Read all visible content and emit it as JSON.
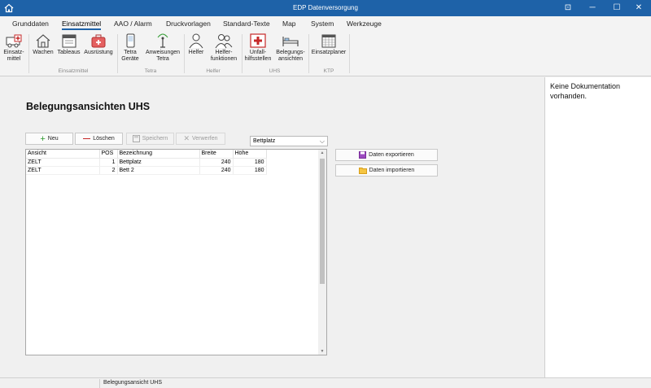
{
  "window": {
    "title": "EDP Datenversorgung",
    "pin_glyph": "⊡",
    "minimize_glyph": "─",
    "maximize_glyph": "☐",
    "close_glyph": "✕"
  },
  "tabs": [
    {
      "label": "Grunddaten"
    },
    {
      "label": "Einsatzmittel",
      "active": true
    },
    {
      "label": "AAO / Alarm"
    },
    {
      "label": "Druckvorlagen"
    },
    {
      "label": "Standard-Texte"
    },
    {
      "label": "Map"
    },
    {
      "label": "System"
    },
    {
      "label": "Werkzeuge"
    }
  ],
  "ribbon": {
    "buttons": [
      {
        "label": "Einsatz-\nmittel",
        "icon": "ambulance-icon"
      },
      {
        "label": "Wachen",
        "icon": "house-icon"
      },
      {
        "label": "Tableaus",
        "icon": "tableau-icon"
      },
      {
        "label": "Ausrüstung",
        "icon": "medkit-icon"
      },
      {
        "label": "Tetra\nGeräte",
        "icon": "phone-icon"
      },
      {
        "label": "Anweisungen\nTetra",
        "icon": "antenna-icon"
      },
      {
        "label": "Helfer",
        "icon": "person-icon"
      },
      {
        "label": "Helfer-\nfunktionen",
        "icon": "people-icon"
      },
      {
        "label": "Unfall-\nhilfsstellen",
        "icon": "first-aid-icon"
      },
      {
        "label": "Belegungs-\nansichten",
        "icon": "bed-icon"
      },
      {
        "label": "Einsatzplaner",
        "icon": "calendar-icon"
      }
    ],
    "groups": [
      "Einsatzmittel",
      "Tetra",
      "Helfer",
      "UHS",
      "KTP"
    ]
  },
  "main": {
    "page_title": "Belegungsansichten UHS",
    "toolbar": {
      "new_label": "Neu",
      "delete_label": "Löschen",
      "save_label": "Speichern",
      "discard_label": "Verwerfen"
    },
    "select": {
      "value": "Bettplatz"
    },
    "table": {
      "columns": [
        "Ansicht",
        "POS",
        "Bezeichnung",
        "Breite",
        "Höhe"
      ],
      "rows": [
        [
          "ZELT",
          "1",
          "Bettplatz",
          "240",
          "180"
        ],
        [
          "ZELT",
          "2",
          "Bett 2",
          "240",
          "180"
        ]
      ]
    },
    "export_label": "Daten exportieren",
    "import_label": "Daten importieren"
  },
  "doc_panel": {
    "text": "Keine Dokumentation vorhanden."
  },
  "status": {
    "text": "Belegungsansicht UHS"
  },
  "colors": {
    "titlebar": "#1e62a8",
    "accent": "#1e62a8",
    "add_green": "#2e9a2e",
    "delete_red": "#c62828"
  }
}
